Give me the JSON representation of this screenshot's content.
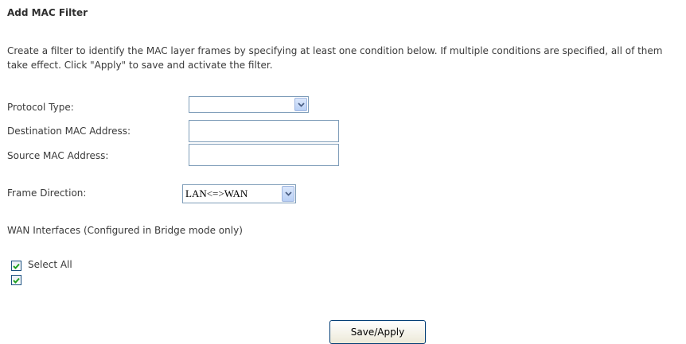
{
  "page": {
    "title": "Add MAC Filter",
    "description": "Create a filter to identify the MAC layer frames by specifying at least one condition below. If multiple conditions are specified, all of them take effect. Click \"Apply\" to save and activate the filter."
  },
  "form": {
    "protocol_type": {
      "label": "Protocol Type:",
      "value": ""
    },
    "destination_mac": {
      "label": "Destination MAC Address:",
      "value": ""
    },
    "source_mac": {
      "label": "Source MAC Address:",
      "value": ""
    },
    "frame_direction": {
      "label": "Frame Direction:",
      "value": "LAN<=>WAN"
    }
  },
  "wan": {
    "heading": "WAN Interfaces (Configured in Bridge mode only)",
    "select_all": {
      "label": "Select All",
      "checked": true
    },
    "interface_checked": true
  },
  "actions": {
    "save_apply": "Save/Apply"
  },
  "colors": {
    "border": "#7f9db9",
    "text": "#3a3a3a",
    "check": "#21a121"
  }
}
